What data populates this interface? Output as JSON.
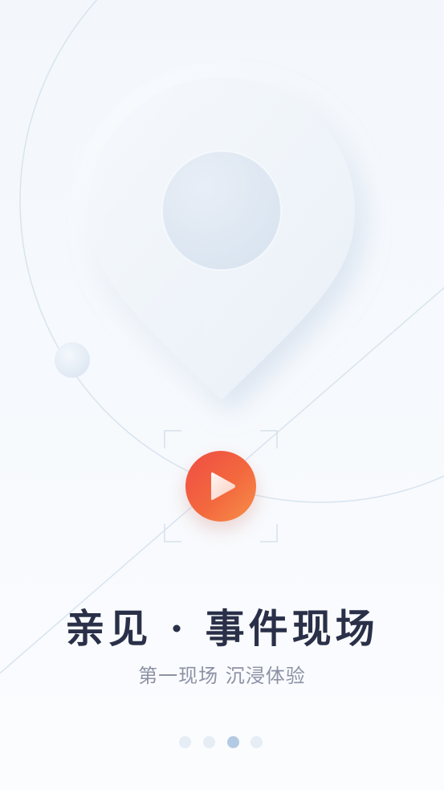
{
  "onboarding": {
    "title": "亲见 · 事件现场",
    "subtitle": "第一现场 沉浸体验",
    "page_indicator": {
      "total": 4,
      "active_index": 2
    }
  },
  "icons": {
    "hero": "map-pin-icon",
    "action": "play-icon"
  },
  "colors": {
    "accent_start": "#ef4d44",
    "accent_end": "#f7904a",
    "title": "#2a3048",
    "subtitle": "#8c92a5",
    "dot_active": "#b3cae3",
    "dot_inactive": "#e6edf5"
  }
}
